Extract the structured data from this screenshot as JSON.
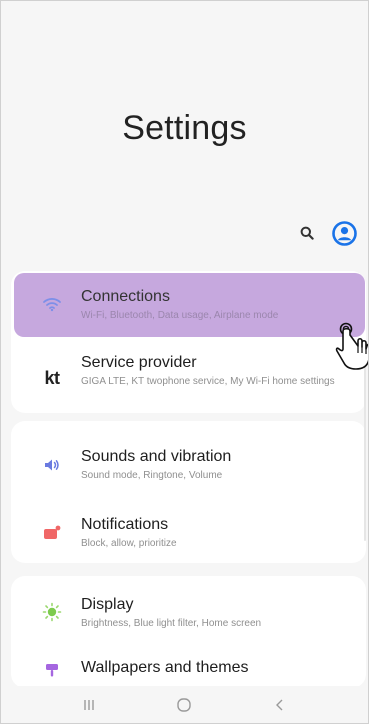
{
  "header": {
    "title": "Settings"
  },
  "menu": [
    {
      "title": "Connections",
      "subtitle": "Wi-Fi, Bluetooth, Data usage, Airplane mode",
      "icon": "wifi-icon",
      "highlighted": true
    },
    {
      "title": "Service provider",
      "subtitle": "GIGA LTE, KT twophone service, My Wi-Fi home settings",
      "icon": "kt-logo",
      "logo_text": "kt"
    },
    {
      "title": "Sounds and vibration",
      "subtitle": "Sound mode, Ringtone, Volume",
      "icon": "speaker-icon"
    },
    {
      "title": "Notifications",
      "subtitle": "Block, allow, prioritize",
      "icon": "notification-icon"
    },
    {
      "title": "Display",
      "subtitle": "Brightness, Blue light filter, Home screen",
      "icon": "sun-icon"
    },
    {
      "title": "Wallpapers and themes",
      "subtitle": "",
      "icon": "paintbrush-icon"
    }
  ],
  "navbar": {
    "recents": "recents-icon",
    "home": "home-icon",
    "back": "back-icon"
  },
  "colors": {
    "highlight": "#c6a8de",
    "accent_blue": "#1a73e8",
    "wifi": "#6c8ef0",
    "sound": "#6a7ae0",
    "notifications": "#f06767",
    "display": "#7dcb4e",
    "wallpaper": "#a566e0"
  }
}
